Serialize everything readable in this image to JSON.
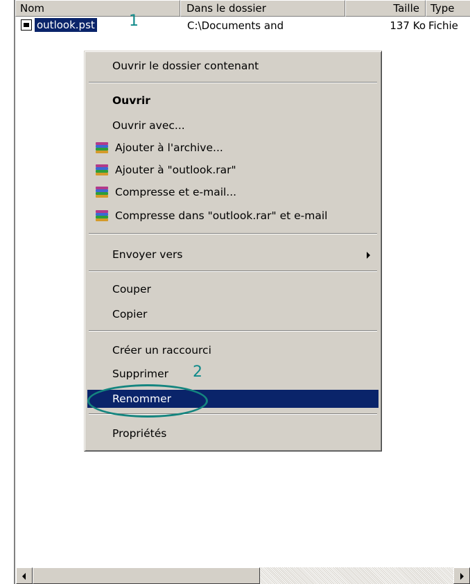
{
  "columns": {
    "name": "Nom",
    "folder": "Dans le dossier",
    "size": "Taille",
    "type": "Type"
  },
  "row": {
    "name": "outlook.pst",
    "folder": "C:\\Documents and",
    "size": "137 Ko",
    "type": "Fichie"
  },
  "markers": {
    "one": "1",
    "two": "2"
  },
  "menu": {
    "open_folder": "Ouvrir le dossier contenant",
    "open": "Ouvrir",
    "open_with": "Ouvrir avec...",
    "add_archive": "Ajouter à l'archive...",
    "add_rar": "Ajouter à \"outlook.rar\"",
    "compress_email": "Compresse et e-mail...",
    "compress_rar_email": "Compresse dans \"outlook.rar\" et e-mail",
    "send_to": "Envoyer vers",
    "cut": "Couper",
    "copy": "Copier",
    "shortcut": "Créer un raccourci",
    "delete": "Supprimer",
    "rename": "Renommer",
    "properties": "Propriétés"
  },
  "colors": {
    "selection": "#0a246a",
    "annotation": "#14857f",
    "menu_bg": "#d4d0c8"
  },
  "icons": {
    "file": "file-icon",
    "rar": "winrar-icon",
    "submenu": "submenu-arrow-icon",
    "scroll_left": "scroll-left-icon",
    "scroll_right": "scroll-right-icon"
  }
}
